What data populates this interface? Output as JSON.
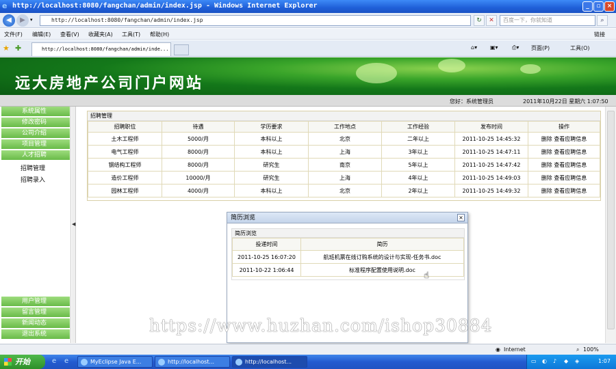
{
  "window": {
    "title": "http://localhost:8080/fangchan/admin/index.jsp - Windows Internet Explorer",
    "address": "http://localhost:8080/fangchan/admin/index.jsp",
    "search_placeholder": "百度一下，你就知道",
    "tab_title": "http://localhost:8080/fangchan/admin/inde...",
    "menu": [
      "文件(F)",
      "编辑(E)",
      "查看(V)",
      "收藏夹(A)",
      "工具(T)",
      "帮助(H)"
    ],
    "menu_right": "链接",
    "toolbar": {
      "page": "页面(P)",
      "tools": "工具(O)"
    }
  },
  "site": {
    "title": "远大房地产公司门户网站",
    "greeting": "您好：系统管理员",
    "date": "2011年10月22日 星期六 1:07:50"
  },
  "sidebar": {
    "items": [
      "系统属性",
      "修改密码",
      "公司介绍",
      "项目管理",
      "人才招聘"
    ],
    "sub_items": [
      "招聘管理",
      "招聘录入"
    ],
    "bottom_items": [
      "用户管理",
      "留言管理",
      "新闻动态",
      "退出系统"
    ]
  },
  "recruit": {
    "panel_title": "招聘管理",
    "headers": [
      "招聘职位",
      "待遇",
      "学历要求",
      "工作地点",
      "工作经验",
      "发布时间",
      "操作"
    ],
    "rows": [
      [
        "土木工程师",
        "5000/月",
        "本科以上",
        "北京",
        "二年以上",
        "2011-10-25 14:45:32"
      ],
      [
        "电气工程师",
        "8000/月",
        "本科以上",
        "上海",
        "3年以上",
        "2011-10-25 14:47:11"
      ],
      [
        "钢结构工程师",
        "8000/月",
        "研究生",
        "南京",
        "5年以上",
        "2011-10-25 14:47:42"
      ],
      [
        "造价工程师",
        "10000/月",
        "研究生",
        "上海",
        "4年以上",
        "2011-10-25 14:49:03"
      ],
      [
        "园林工程师",
        "4000/月",
        "本科以上",
        "北京",
        "2年以上",
        "2011-10-25 14:49:32"
      ]
    ],
    "action_delete": "删除",
    "action_view": "查看应聘信息"
  },
  "dialog": {
    "title": "简历浏览",
    "close": "×",
    "inner_title": "简历浏览",
    "headers": [
      "投递时间",
      "简历"
    ],
    "rows": [
      [
        "2011-10-25 16:07:20",
        "航班机票在线订购系统的设计与实现-任务书.doc"
      ],
      [
        "2011-10-22 1:06:44",
        "标准程序配置使用说明.doc"
      ]
    ]
  },
  "watermark": "https://www.huzhan.com/ishop30884",
  "statusbar": {
    "zone": "Internet",
    "zoom": "100%"
  },
  "taskbar": {
    "start": "开始",
    "tasks": [
      "MyEclipse Java E...",
      "http://localhost...",
      "http://localhost..."
    ],
    "clock": "1:07"
  },
  "colors": {
    "banner_green": "#14781a",
    "sidebar_green": "#69bb48",
    "ie_blue": "#1f5fd8"
  }
}
